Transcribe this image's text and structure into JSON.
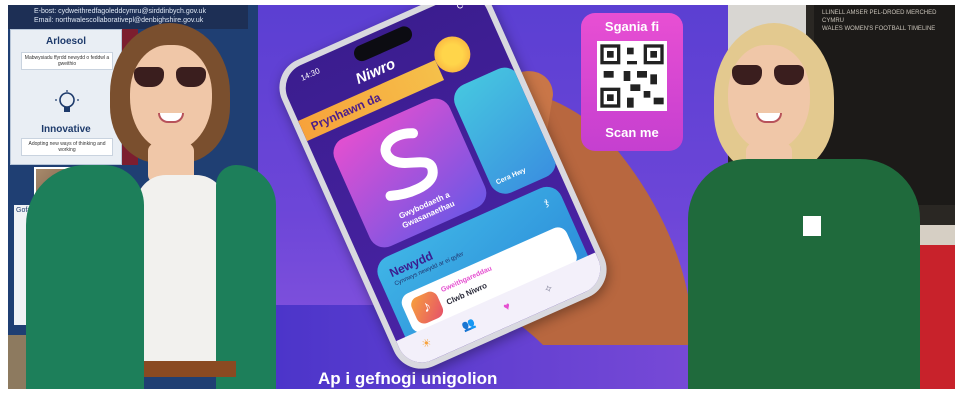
{
  "photo": {
    "left_board": {
      "contact_lines": [
        "E-bost: cydweithredfagoleddcymru@sirddinbych.gov.uk",
        "Email: northwalescollaborativepl@denbighshire.gov.uk"
      ],
      "heading_top": "Arloesol",
      "text_top": "Mabwysiadu ffyrdd newydd o feddwl a gweithio",
      "heading_bottom": "Innovative",
      "text_bottom": "Adopting new ways of thinking and working",
      "side_label": "Gofal"
    },
    "banner": {
      "bottom_text": "Ap i gefnogi unigolion"
    },
    "phone": {
      "time": "14:30",
      "app_name": "Niwro",
      "greeting": "Prynhawn da",
      "card_main_label": "Gwybodaeth a Gwasanaethau",
      "card_side_label": "Cera Hwy",
      "news_title": "Newydd",
      "news_subtitle": "Cynnwys newydd ar ei gyfer",
      "news_category": "Gweithgareddau",
      "news_item": "Clwb Niwro"
    },
    "qr": {
      "top_text": "Sgania fi",
      "bottom_text": "Scan me"
    },
    "right_board": {
      "lines": [
        "LLINELL AMSER PEL-DROED MERCHED CYMRU",
        "WALES WOMEN'S FOOTBALL TIMELINE"
      ]
    },
    "colors": {
      "banner_purple": "#5b3fd2",
      "qr_pink": "#e84fd3",
      "cardigan_green": "#1d7f5a",
      "polo_green": "#1f6a3c"
    }
  }
}
